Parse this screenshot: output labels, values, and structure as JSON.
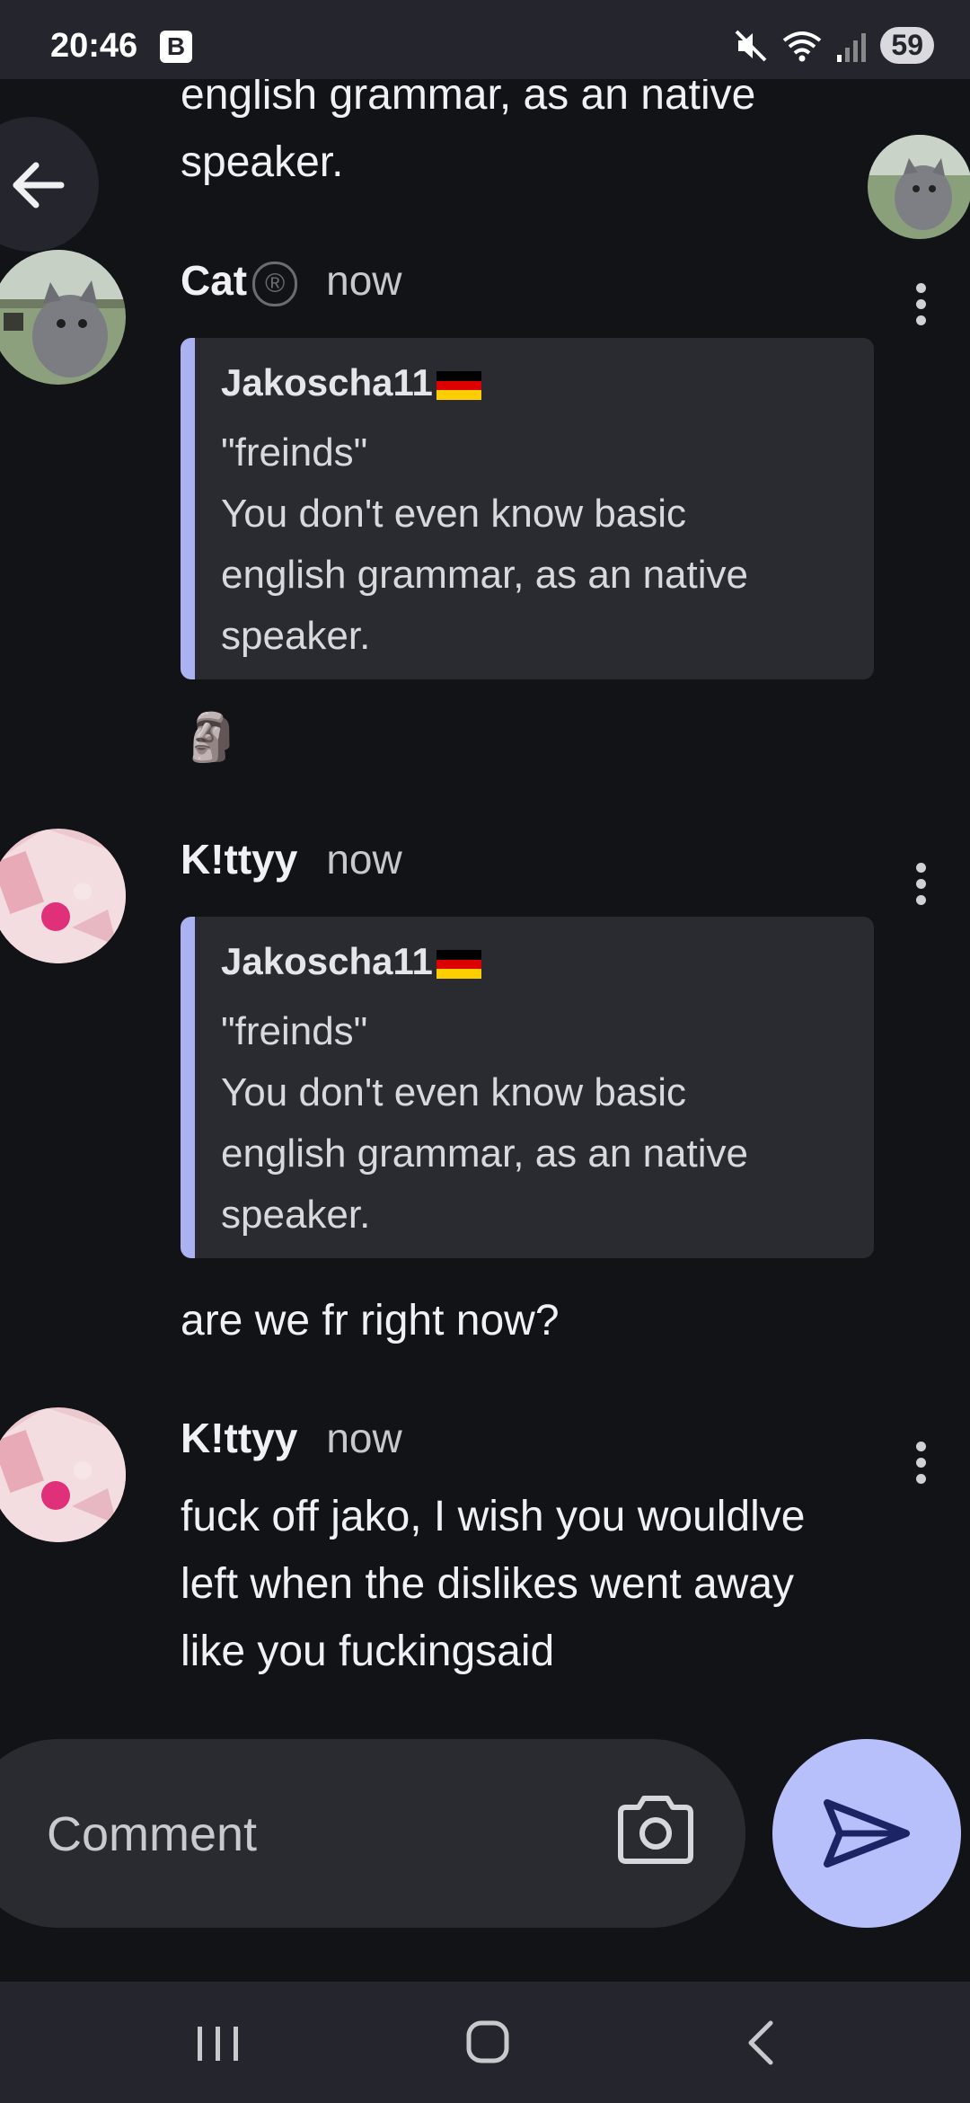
{
  "status_bar": {
    "time": "20:46",
    "badge": "B",
    "battery": "59"
  },
  "messages": {
    "prev_tail": [
      "english grammar, as an native",
      "speaker."
    ],
    "m1": {
      "author": "Cat",
      "author_mark": "®",
      "time": "now",
      "quote": {
        "author": "Jakoscha11",
        "lines": [
          "\"freinds\"",
          "You don't even know basic",
          "english grammar, as an native",
          "speaker."
        ]
      },
      "emoji": "🗿"
    },
    "m2": {
      "author": "K!ttyy",
      "time": "now",
      "quote": {
        "author": "Jakoscha11",
        "lines": [
          "\"freinds\"",
          "You don't even know basic",
          "english grammar, as an native",
          "speaker."
        ]
      },
      "text": "are we fr right now?"
    },
    "m3": {
      "author": "K!ttyy",
      "time": "now",
      "lines": [
        "fuck off jako, I wish you wouldlve",
        "left when the dislikes went away",
        "like you fuckingsaid"
      ]
    }
  },
  "composer": {
    "placeholder": "Comment"
  },
  "colors": {
    "background": "#121317",
    "surface": "#2a2b31",
    "accent": "#b7c0fb",
    "quote_bar": "#aab2f2"
  }
}
